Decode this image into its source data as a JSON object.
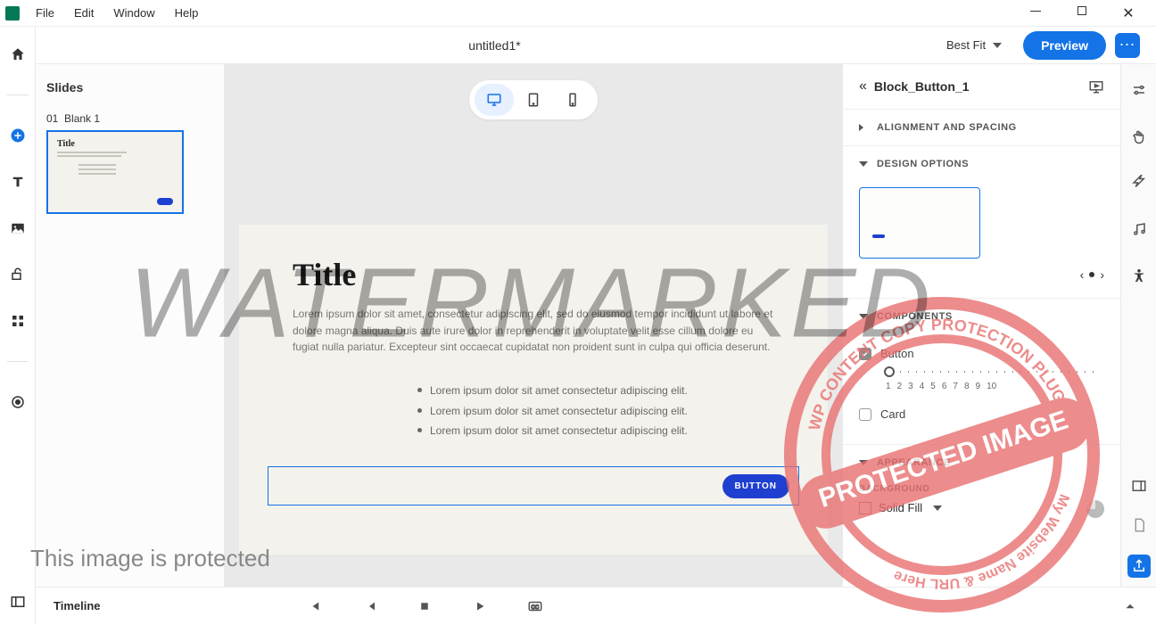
{
  "menu": {
    "file": "File",
    "edit": "Edit",
    "window": "Window",
    "help": "Help"
  },
  "doc": {
    "title": "untitled1*",
    "zoom": "Best Fit",
    "preview": "Preview"
  },
  "slides": {
    "heading": "Slides",
    "items": [
      {
        "num": "01",
        "name": "Blank 1",
        "title": "Title"
      }
    ]
  },
  "canvas": {
    "title": "Title",
    "paragraph": "Lorem ipsum dolor sit amet, consectetur adipiscing elit, sed do eiusmod tempor incididunt ut labore et dolore magna aliqua. Duis aute irure dolor in reprehenderit in voluptate velit esse cillum dolore eu fugiat nulla pariatur. Excepteur sint occaecat cupidatat non proident sunt in culpa qui officia deserunt.",
    "bullets": [
      "Lorem ipsum dolor sit amet consectetur adipiscing elit.",
      "Lorem ipsum dolor sit amet consectetur adipiscing elit.",
      "Lorem ipsum dolor sit amet consectetur adipiscing elit."
    ],
    "button": "BUTTON"
  },
  "props": {
    "selected": "Block_Button_1",
    "sections": {
      "alignment": "ALIGNMENT AND SPACING",
      "design": "DESIGN OPTIONS",
      "components": "COMPONENTS",
      "appearance": "APPEARANCE"
    },
    "components": {
      "button": "Button",
      "card": "Card",
      "slider_min": "1",
      "ticks": [
        "1",
        "2",
        "3",
        "4",
        "5",
        "6",
        "7",
        "8",
        "9",
        "10"
      ]
    },
    "appearance": {
      "bg_label": "BACKGROUND",
      "fill": "Solid Fill"
    }
  },
  "timeline": {
    "label": "Timeline"
  },
  "watermark": {
    "big": "WATERMARKED",
    "protected": "This image is protected"
  }
}
